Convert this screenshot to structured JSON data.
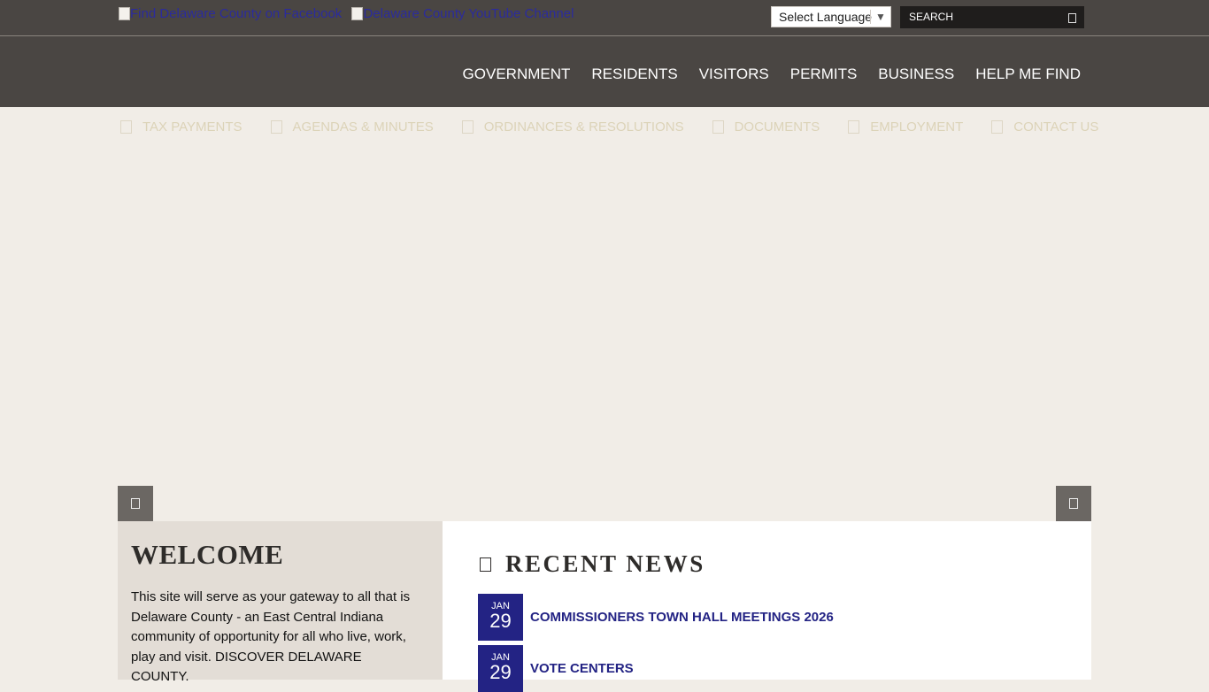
{
  "topbar": {
    "facebook_alt": "Find Delaware County on Facebook",
    "youtube_alt": "Delaware County YouTube Channel",
    "language": "Select Language",
    "search_placeholder": "SEARCH"
  },
  "nav": [
    "GOVERNMENT",
    "RESIDENTS",
    "VISITORS",
    "PERMITS",
    "BUSINESS",
    "HELP ME FIND"
  ],
  "quick_links": [
    "TAX PAYMENTS",
    "AGENDAS & MINUTES",
    "ORDINANCES & RESOLUTIONS",
    "DOCUMENTS",
    "EMPLOYMENT",
    "CONTACT US"
  ],
  "welcome": {
    "title": "WELCOME",
    "body": "This site will serve as your gateway to all that is Delaware County - an East Central Indiana community of opportunity for all who live, work, play and visit. DISCOVER DELAWARE COUNTY."
  },
  "news": {
    "title": "RECENT NEWS",
    "items": [
      {
        "month": "JAN",
        "day": "29",
        "title": "COMMISSIONERS TOWN HALL MEETINGS 2026"
      },
      {
        "month": "JAN",
        "day": "29",
        "title": "VOTE CENTERS"
      }
    ]
  },
  "colors": {
    "header": "#4a4643",
    "accent": "#232384",
    "background": "#f1ede7"
  }
}
